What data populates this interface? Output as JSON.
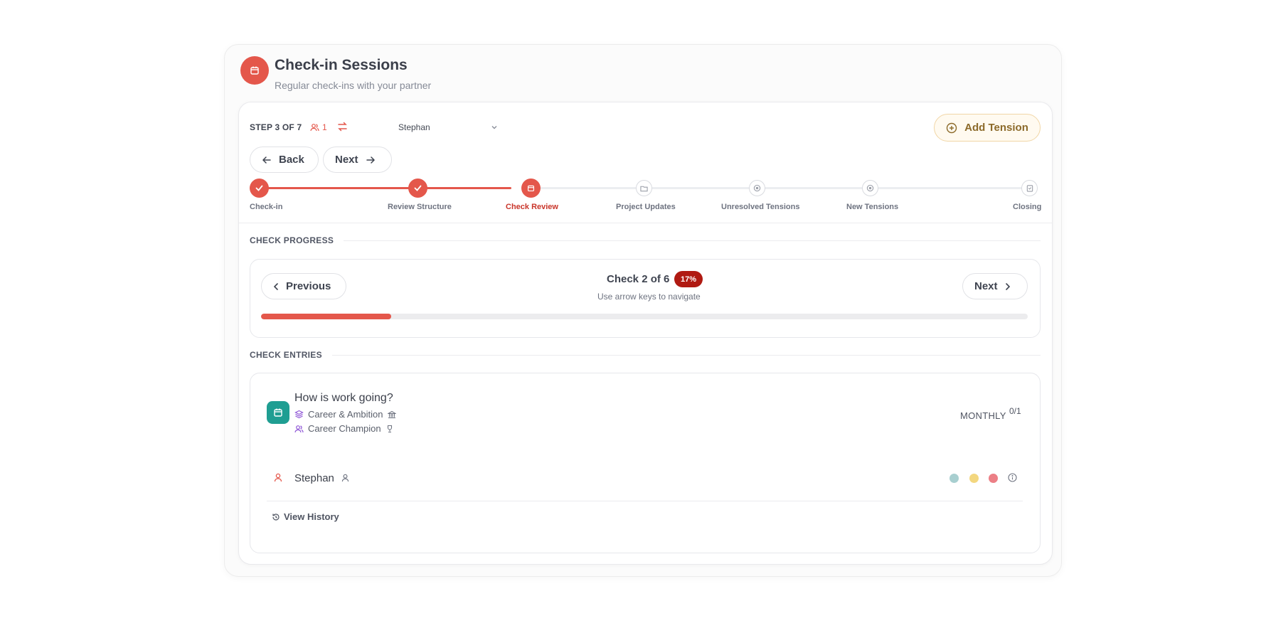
{
  "header": {
    "title": "Check-in Sessions",
    "subtitle": "Regular check-ins with your partner",
    "icon": "calendar-icon"
  },
  "toolbar": {
    "step_label": "STEP 3 OF 7",
    "user_count": "1",
    "partner": "Stephan",
    "back_label": "Back",
    "next_label": "Next",
    "add_tension_label": "Add Tension"
  },
  "steps": [
    {
      "label": "Check-in",
      "state": "done"
    },
    {
      "label": "Review Structure",
      "state": "done"
    },
    {
      "label": "Check Review",
      "state": "active"
    },
    {
      "label": "Project Updates",
      "state": "pending"
    },
    {
      "label": "Unresolved Tensions",
      "state": "pending"
    },
    {
      "label": "New Tensions",
      "state": "pending"
    },
    {
      "label": "Closing",
      "state": "pending"
    }
  ],
  "progress": {
    "section_label": "CHECK PROGRESS",
    "previous_label": "Previous",
    "next_label": "Next",
    "check_count": "Check 2 of 6",
    "percent": "17%",
    "percent_value": 0.17,
    "hint": "Use arrow keys to navigate"
  },
  "entries": {
    "section_label": "CHECK ENTRIES",
    "title": "How is work going?",
    "area": "Career & Ambition",
    "role": "Career Champion",
    "frequency": "MONTHLY",
    "ratio": "0/1",
    "person": "Stephan",
    "view_history_label": "View History"
  },
  "colors": {
    "accent": "#e4574b",
    "badge": "#b01a12",
    "entry_icon": "#1f9e92",
    "dot_teal": "#a8cfd0",
    "dot_yellow": "#f3d77f",
    "dot_red": "#ec7f86"
  }
}
